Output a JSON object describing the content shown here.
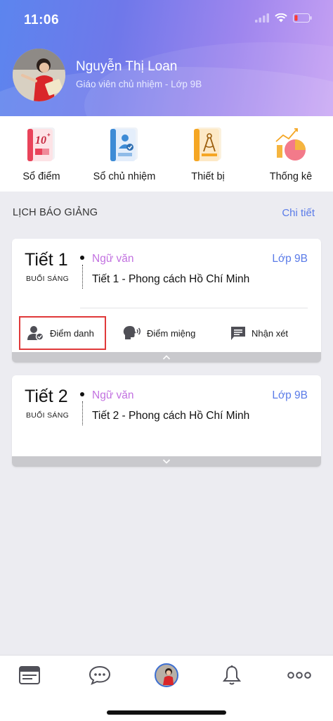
{
  "status_bar": {
    "time": "11:06"
  },
  "profile": {
    "name": "Nguyễn Thị Loan",
    "role": "Giáo viên chủ nhiệm - Lớp 9B"
  },
  "quick_menu": [
    {
      "label": "Sổ điểm",
      "icon": "gradebook-icon"
    },
    {
      "label": "Sổ chủ nhiệm",
      "icon": "homeroom-book-icon"
    },
    {
      "label": "Thiết bị",
      "icon": "equipment-icon"
    },
    {
      "label": "Thống kê",
      "icon": "statistics-icon"
    }
  ],
  "schedule": {
    "title": "LỊCH BÁO GIẢNG",
    "detail_link": "Chi tiết",
    "lessons": [
      {
        "period": "Tiết 1",
        "session": "BUỔI SÁNG",
        "subject": "Ngữ văn",
        "topic": "Tiết 1 - Phong cách Hồ Chí Minh",
        "class": "Lớp 9B",
        "actions": [
          "Điểm danh",
          "Điểm miệng",
          "Nhận xét"
        ]
      },
      {
        "period": "Tiết 2",
        "session": "BUỔI SÁNG",
        "subject": "Ngữ văn",
        "topic": "Tiết 2 - Phong cách Hồ Chí Minh",
        "class": "Lớp 9B"
      }
    ]
  },
  "tab_bar": [
    "news-icon",
    "chat-icon",
    "profile-avatar",
    "bell-icon",
    "more-icon"
  ],
  "colors": {
    "accent": "#5a7be8",
    "subject": "#c271e0",
    "highlight_border": "#e0393a"
  }
}
